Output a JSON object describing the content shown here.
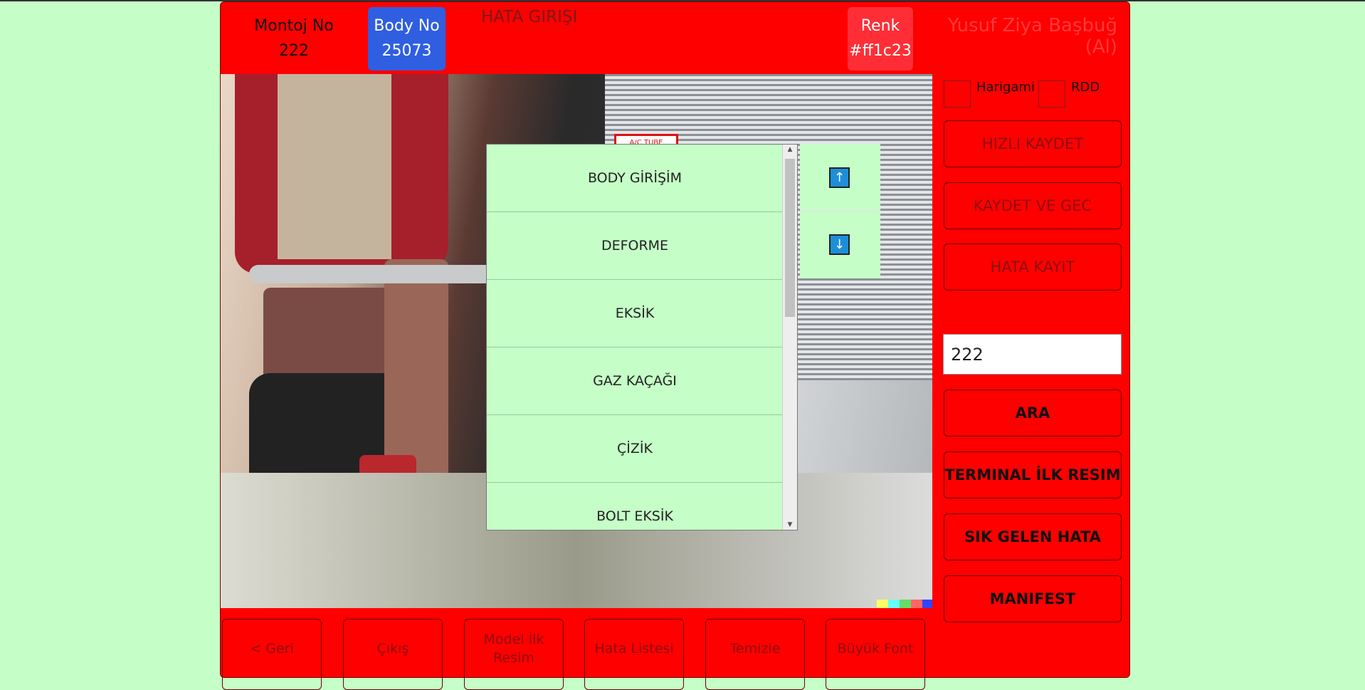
{
  "header": {
    "montoj_label": "Montoj No",
    "montoj_value": "222",
    "body_label": "Body No",
    "body_value": "25073",
    "title": "HATA GIRIŞI",
    "renk_label": "Renk",
    "renk_value": "#ff1c23",
    "user": "Yusuf Ziya Başbuğ (Al)"
  },
  "photo": {
    "tag": "A/C TUBE",
    "swatches": [
      "#ffff66",
      "#66ffff",
      "#66dd66",
      "#ff6666",
      "#3344ff"
    ]
  },
  "checkboxes": [
    {
      "label": "Harigami"
    },
    {
      "label": "RDD"
    }
  ],
  "actions": {
    "hizli_kaydet": "HIZLI KAYDET",
    "kaydet_ve_gec": "KAYDET VE GEC",
    "hata_kayit": "HATA KAYIT"
  },
  "search": {
    "value": "222"
  },
  "tools": {
    "ara": "ARA",
    "terminal_ilk_resim": "TERMINAL İLK RESIM",
    "sik_gelen_hata": "SIK GELEN HATA",
    "manifest": "MANIFEST"
  },
  "popup": {
    "items": [
      "BODY GİRİŞİM",
      "DEFORME",
      "EKSİK",
      "GAZ KAÇAĞI",
      "ÇİZİK",
      "BOLT EKSİK"
    ],
    "up_icon": "↑",
    "down_icon": "↓"
  },
  "bottom": {
    "geri": "< Geri",
    "cikis": "Çıkış",
    "model_ilk_resim": "Model İlk Resim",
    "hata_listesi": "Hata Listesi",
    "temizle": "Temizle",
    "buyuk_font": "Büyük Font"
  },
  "colors": {
    "background": "#c5fec7",
    "panel": "#ff0000",
    "body_badge": "#2f5fe0",
    "renk_badge": "#ff2e36",
    "popup": "#c5fec7",
    "arrow_button": "#1e8ed8"
  }
}
